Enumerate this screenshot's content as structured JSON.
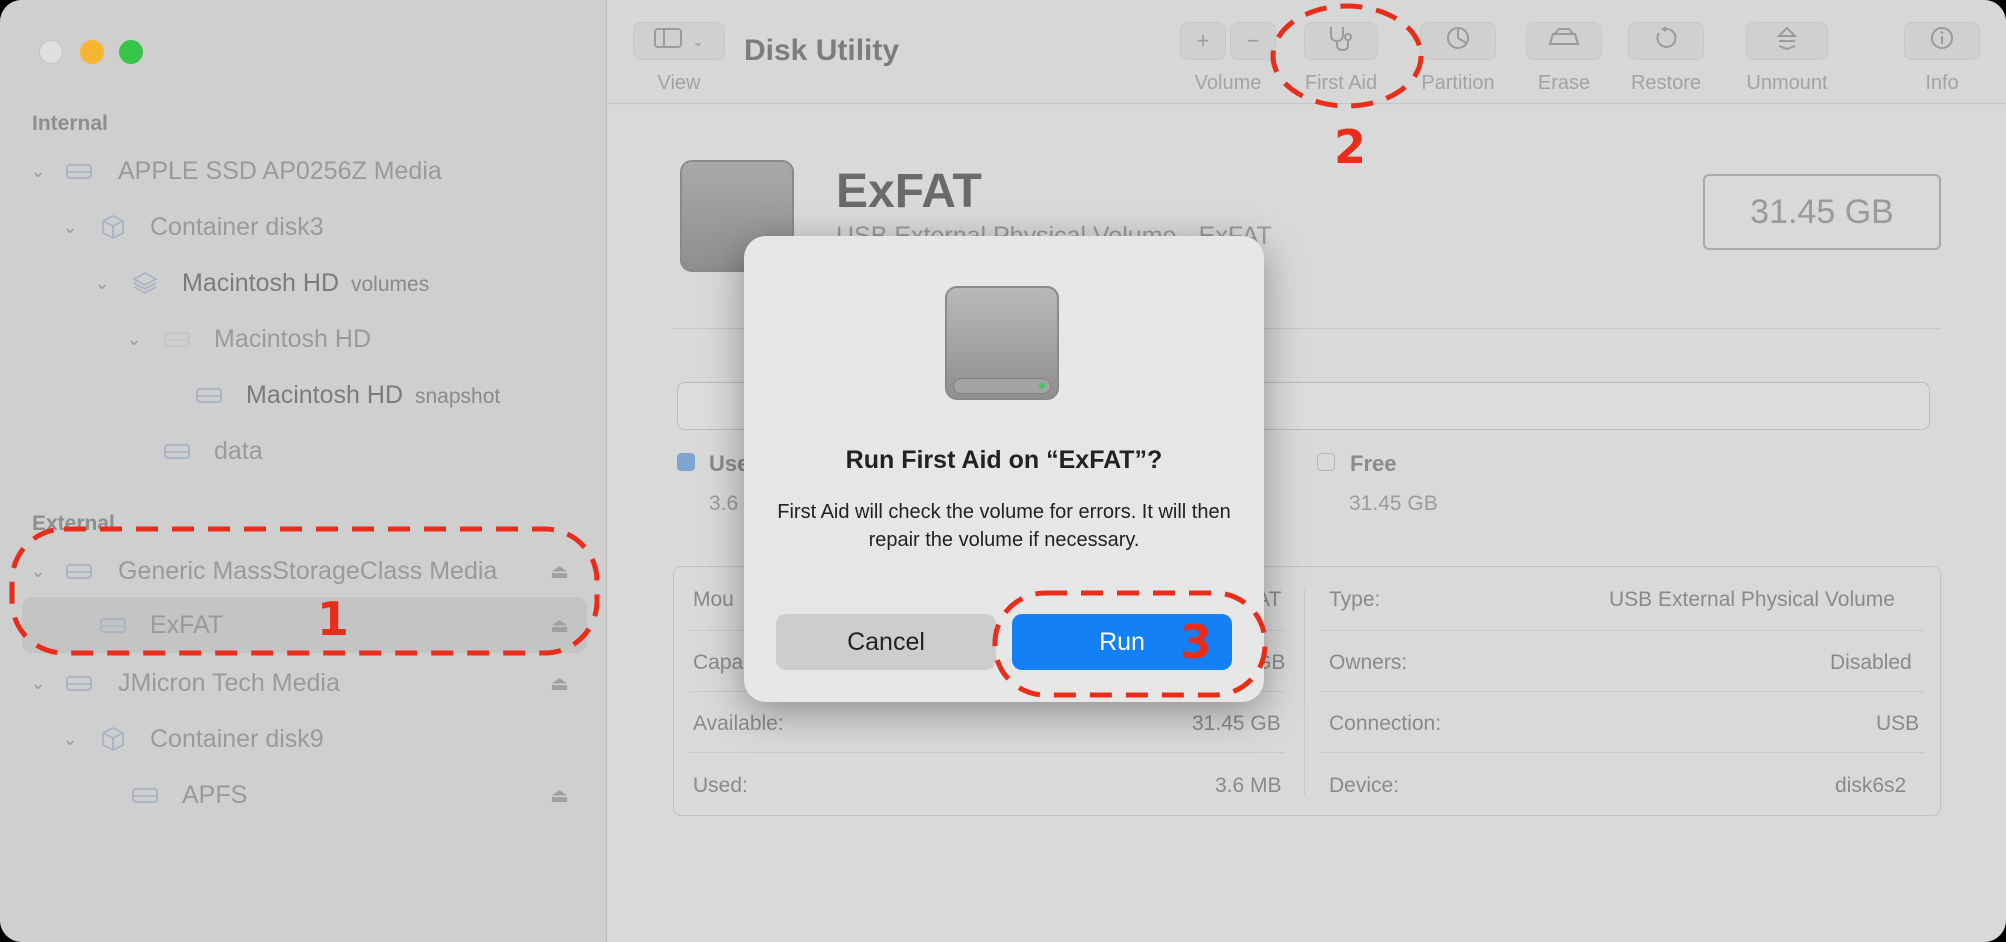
{
  "app": {
    "title": "Disk Utility"
  },
  "sidebar": {
    "internal_label": "Internal",
    "external_label": "External",
    "items": [
      {
        "label": "APPLE SSD AP0256Z Media",
        "sub": ""
      },
      {
        "label": "Container disk3",
        "sub": ""
      },
      {
        "label": "Macintosh HD",
        "sub": "volumes"
      },
      {
        "label": "Macintosh HD",
        "sub": ""
      },
      {
        "label": "Macintosh HD",
        "sub": "snapshot"
      },
      {
        "label": "data",
        "sub": ""
      },
      {
        "label": "Generic MassStorageClass Media",
        "sub": ""
      },
      {
        "label": "ExFAT",
        "sub": ""
      },
      {
        "label": "JMicron Tech Media",
        "sub": ""
      },
      {
        "label": "Container disk9",
        "sub": ""
      },
      {
        "label": "APFS",
        "sub": ""
      }
    ]
  },
  "toolbar": {
    "view": "View",
    "volume": "Volume",
    "first_aid": "First Aid",
    "partition": "Partition",
    "erase": "Erase",
    "restore": "Restore",
    "unmount": "Unmount",
    "info": "Info"
  },
  "volume": {
    "name": "ExFAT",
    "subtitle": "USB External Physical Volume · ExFAT",
    "size": "31.45 GB",
    "used_label": "Use",
    "used_value": "3.6",
    "free_label": "Free",
    "free_value": "31.45 GB"
  },
  "info": {
    "left": [
      {
        "label": "Mou",
        "value": "AT"
      },
      {
        "label": "Capa",
        "value": "GB"
      },
      {
        "label": "Available:",
        "value": "31.45 GB"
      },
      {
        "label": "Used:",
        "value": "3.6 MB"
      }
    ],
    "right": [
      {
        "label": "Type:",
        "value": "USB External Physical Volume"
      },
      {
        "label": "Owners:",
        "value": "Disabled"
      },
      {
        "label": "Connection:",
        "value": "USB"
      },
      {
        "label": "Device:",
        "value": "disk6s2"
      }
    ]
  },
  "dialog": {
    "title": "Run First Aid on “ExFAT”?",
    "message": "First Aid will check the volume for errors. It will then repair the volume if necessary.",
    "cancel": "Cancel",
    "run": "Run"
  },
  "annotations": {
    "one": "1",
    "two": "2",
    "three": "3"
  },
  "colors": {
    "accent": "#1480f5",
    "annotation": "#ea2d1a"
  }
}
